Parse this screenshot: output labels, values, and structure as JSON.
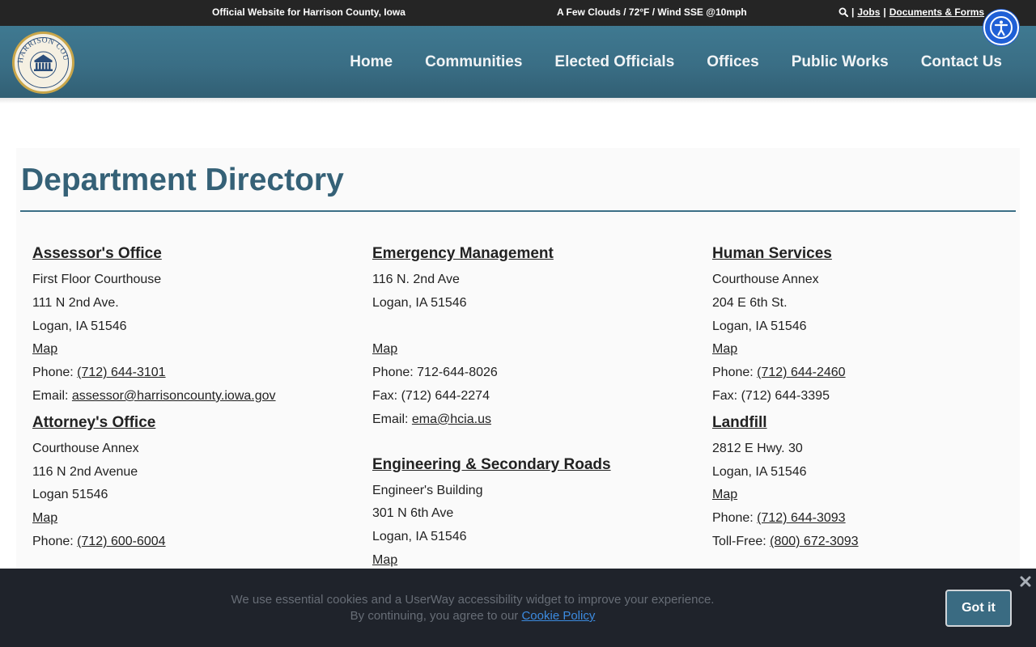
{
  "topbar": {
    "official": "Official Website for Harrison County, Iowa",
    "weather": "A Few Clouds / 72°F / Wind SSE @10mph",
    "separator": "|",
    "jobs": "Jobs",
    "documents": "Documents & Forms"
  },
  "logo": {
    "text": "HARRISON COUNTY"
  },
  "nav": {
    "home": "Home",
    "communities": "Communities",
    "elected": "Elected Officials",
    "offices": "Offices",
    "public_works": "Public Works",
    "contact": "Contact Us"
  },
  "page": {
    "title": "Department Directory"
  },
  "departments": {
    "assessor": {
      "name": "Assessor's Office",
      "line1": "First Floor Courthouse",
      "line2": "111 N 2nd Ave.",
      "line3": "Logan, IA 51546",
      "map": "Map",
      "phone_label": "Phone: ",
      "phone": "(712) 644-3101",
      "email_label": "Email: ",
      "email": "assessor@harrisoncounty.iowa.gov"
    },
    "attorney": {
      "name": "Attorney's Office",
      "line1": "Courthouse Annex",
      "line2": "116 N 2nd Avenue",
      "line3": "Logan 51546",
      "map": "Map",
      "phone_label": "Phone: ",
      "phone": "(712) 600-6004"
    },
    "emergency": {
      "name": "Emergency Management",
      "line1": "116 N. 2nd Ave",
      "line2": "Logan, IA 51546",
      "map": "Map",
      "phone": "Phone: 712-644-8026",
      "fax": "Fax:  (712) 644-2274",
      "email_label": "Email:  ",
      "email": "ema@hcia.us"
    },
    "engineering": {
      "name": "Engineering & Secondary Roads",
      "line1": "Engineer's Building",
      "line2": "301 N 6th Ave",
      "line3": "Logan, IA 51546",
      "map": "Map"
    },
    "human": {
      "name": "Human Services",
      "line1": "Courthouse Annex",
      "line2": "204 E 6th St.",
      "line3": "Logan, IA 51546",
      "map": "Map",
      "phone_label": "Phone: ",
      "phone": "(712) 644-2460",
      "fax": "Fax: (712) 644-3395"
    },
    "landfill": {
      "name": "Landfill",
      "line1": "2812 E Hwy. 30",
      "line2": "Logan, IA 51546",
      "map": "Map",
      "phone_label": "Phone:  ",
      "phone": "(712) 644-3093",
      "tollfree_label": "Toll-Free:  ",
      "tollfree": "(800) 672-3093"
    }
  },
  "cookie": {
    "line1": "We use essential cookies and a UserWay accessibility widget to improve your experience.",
    "line2": "By continuing, you agree to our ",
    "policy": "Cookie Policy",
    "button": "Got it"
  },
  "colors": {
    "header": "#3a6e85",
    "title": "#356177",
    "topbar": "#252525",
    "cookie_bg": "#1f232b",
    "accessibility": "#1f5fd6"
  },
  "icons": {
    "search": "search-icon",
    "accessibility": "accessibility-icon",
    "close": "close-icon",
    "courthouse": "courthouse-icon"
  }
}
